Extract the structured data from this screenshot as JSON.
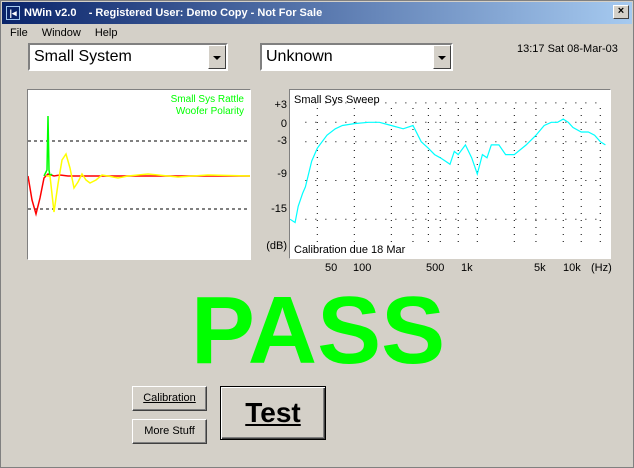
{
  "window": {
    "title": "NWin v2.0    - Registered User: Demo Copy - Not For Sale",
    "app_icon": "|◂",
    "close": "×"
  },
  "menu": [
    "File",
    "Window",
    "Help"
  ],
  "system_select": {
    "value": "Small System"
  },
  "status_select": {
    "value": "Unknown"
  },
  "datetime": "13:17 Sat 08-Mar-03",
  "left_panel": {
    "legend_line1": "Small Sys Rattle",
    "legend_line2": "Woofer Polarity",
    "legend_color": "#00ff00"
  },
  "chart_data": {
    "type": "line",
    "title": "Small Sys Sweep",
    "annotation": "Calibration due 18 Mar",
    "ylabel": "(dB)",
    "xlabel": "(Hz)",
    "yticks": [
      "+3",
      "0",
      "-3",
      "-9",
      "-15"
    ],
    "xticks": [
      "50",
      "100",
      "500",
      "1k",
      "5k",
      "10k"
    ],
    "x_scale": "log",
    "xlim": [
      30,
      12000
    ],
    "ylim": [
      -21,
      5
    ],
    "series": [
      {
        "color": "#00ffff",
        "x": [
          30,
          33,
          35,
          38,
          40,
          45,
          50,
          60,
          70,
          80,
          100,
          130,
          160,
          200,
          250,
          300,
          350,
          400,
          450,
          500,
          550,
          600,
          650,
          700,
          800,
          900,
          1000,
          1100,
          1200,
          1300,
          1500,
          1700,
          2000,
          2500,
          3000,
          3500,
          4000,
          4500,
          5000,
          5500,
          6000,
          7000,
          8000,
          9000,
          10000,
          11000
        ],
        "y": [
          -15,
          -15.5,
          -13,
          -11,
          -10,
          -6,
          -4,
          -2,
          -1,
          -0.5,
          -0.2,
          0,
          0,
          -0.5,
          -1,
          -0.5,
          -3,
          -4,
          -5,
          -5.5,
          -6,
          -6.5,
          -4.5,
          -5,
          -3.5,
          -5.5,
          -8,
          -5,
          -5.5,
          -3.5,
          -3.5,
          -5,
          -5,
          -3.5,
          -2,
          -0.5,
          0,
          0,
          0.5,
          0,
          -0.8,
          -1.5,
          -1.5,
          -2,
          -3,
          -3.5
        ]
      }
    ]
  },
  "result": "PASS",
  "result_color": "#00ff00",
  "buttons": {
    "calibration": "Calibration",
    "more_stuff": "More Stuff",
    "test": "Test"
  }
}
